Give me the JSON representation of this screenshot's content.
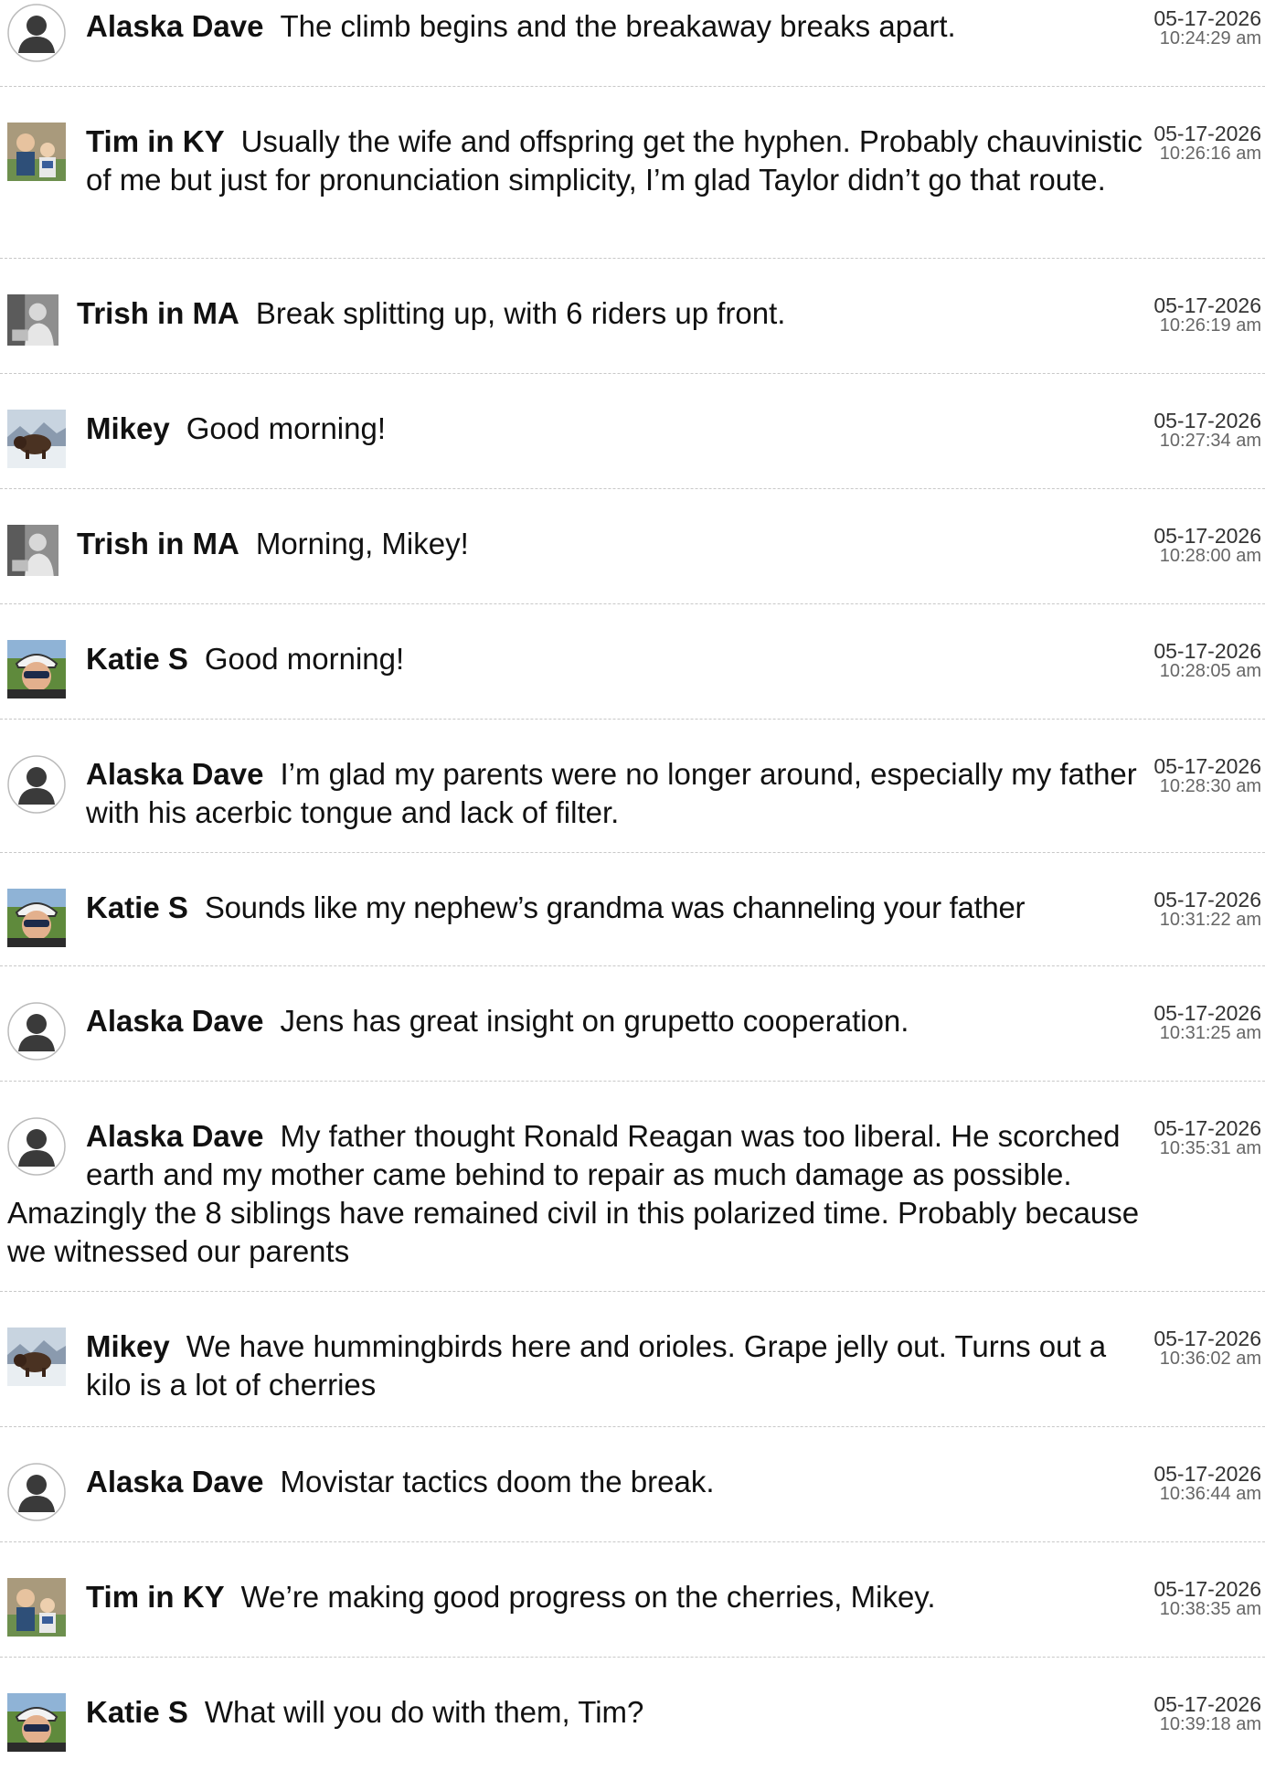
{
  "messages": [
    {
      "user": "Alaska Dave",
      "text": "The climb begins and the breakaway breaks apart.",
      "date": "05-17-2026",
      "time": "10:24:29 am",
      "avatar": "default-user-icon"
    },
    {
      "user": "Tim in KY",
      "text": "Usually the wife and offspring get the hyphen. Probably chauvinistic of me but just for pronunciation simplicity, I’m glad Taylor didn’t go that route.",
      "date": "05-17-2026",
      "time": "10:26:16 am",
      "avatar": "family-photo"
    },
    {
      "user": "Trish in MA",
      "text": "Break splitting up, with 6 riders up front.",
      "date": "05-17-2026",
      "time": "10:26:19 am",
      "avatar": "bw-photo"
    },
    {
      "user": "Mikey",
      "text": "Good morning!",
      "date": "05-17-2026",
      "time": "10:27:34 am",
      "avatar": "bison-photo"
    },
    {
      "user": "Trish in MA",
      "text": "Morning, Mikey!",
      "date": "05-17-2026",
      "time": "10:28:00 am",
      "avatar": "bw-photo"
    },
    {
      "user": "Katie S",
      "text": "Good morning!",
      "date": "05-17-2026",
      "time": "10:28:05 am",
      "avatar": "cyclist-photo"
    },
    {
      "user": "Alaska Dave",
      "text": "I’m glad my parents were no longer around, especially my father with his acerbic tongue and lack of filter.",
      "date": "05-17-2026",
      "time": "10:28:30 am",
      "avatar": "default-user-icon"
    },
    {
      "user": "Katie S",
      "text": "Sounds like my nephew’s grandma was channeling your father",
      "date": "05-17-2026",
      "time": "10:31:22 am",
      "avatar": "cyclist-photo"
    },
    {
      "user": "Alaska Dave",
      "text": "Jens has great insight on grupetto cooperation.",
      "date": "05-17-2026",
      "time": "10:31:25 am",
      "avatar": "default-user-icon"
    },
    {
      "user": "Alaska Dave",
      "text": "My father thought Ronald Reagan was too liberal. He scorched earth and my mother came behind to repair as much damage as possible. Amazingly the 8 siblings have remained civil in this polarized time. Probably because we witnessed our parents",
      "date": "05-17-2026",
      "time": "10:35:31 am",
      "avatar": "default-user-icon"
    },
    {
      "user": "Mikey",
      "text": "We have hummingbirds here and orioles. Grape jelly out. Turns out a kilo is a lot of cherries",
      "date": "05-17-2026",
      "time": "10:36:02 am",
      "avatar": "bison-photo"
    },
    {
      "user": "Alaska Dave",
      "text": "Movistar tactics doom the break.",
      "date": "05-17-2026",
      "time": "10:36:44 am",
      "avatar": "default-user-icon"
    },
    {
      "user": "Tim in KY",
      "text": "We’re making good progress on the cherries, Mikey.",
      "date": "05-17-2026",
      "time": "10:38:35 am",
      "avatar": "family-photo"
    },
    {
      "user": "Katie S",
      "text": "What will you do with them, Tim?",
      "date": "05-17-2026",
      "time": "10:39:18 am",
      "avatar": "cyclist-photo"
    }
  ]
}
